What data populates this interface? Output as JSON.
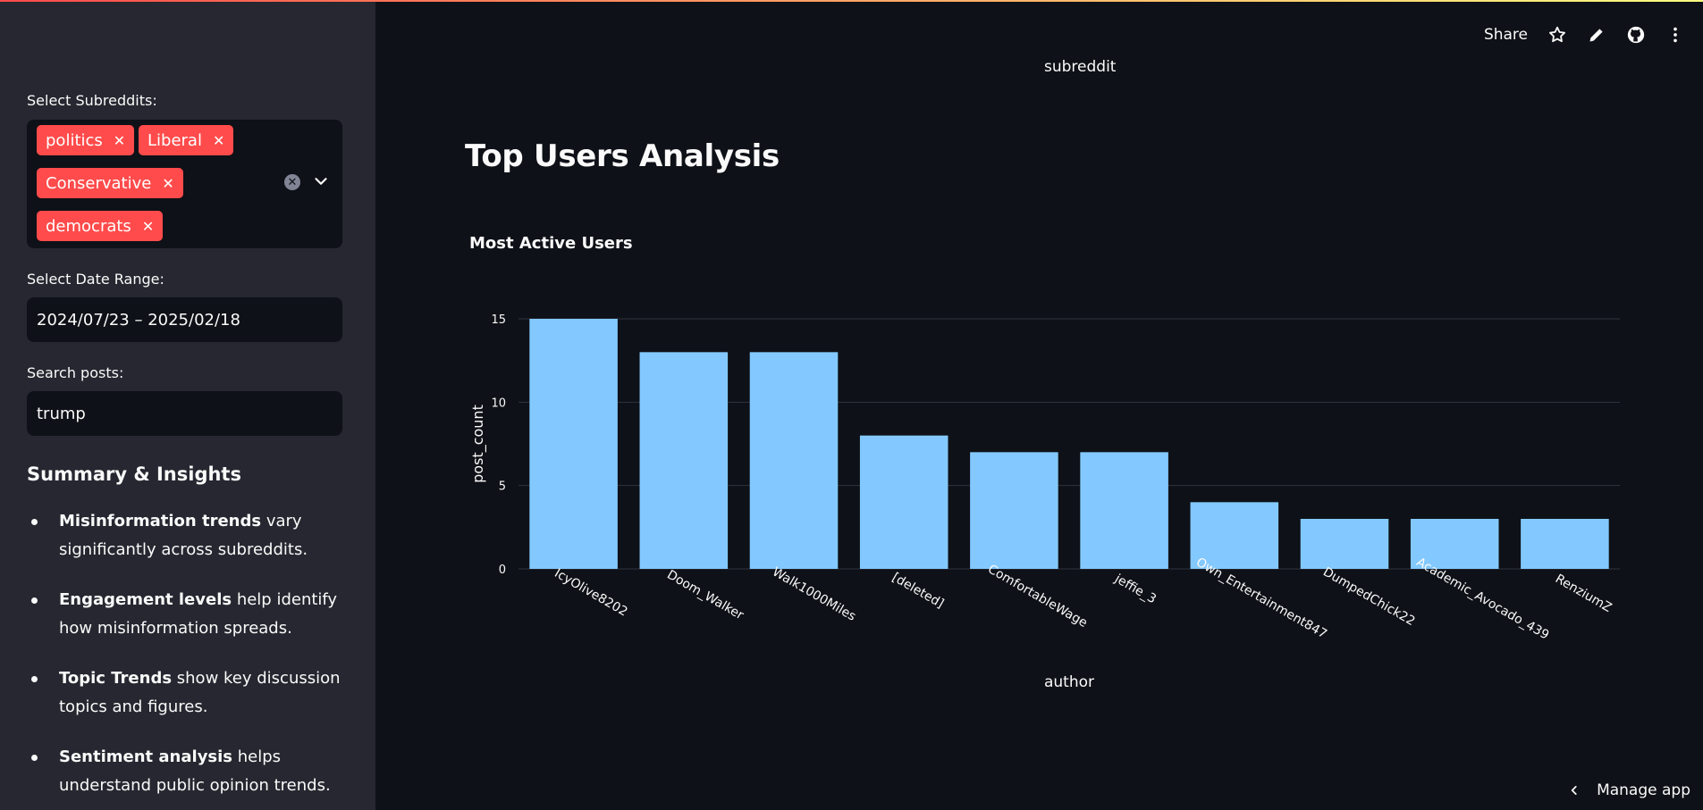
{
  "sidebar": {
    "subreddits_label": "Select Subreddits:",
    "subreddits": [
      {
        "label": "politics"
      },
      {
        "label": "Liberal"
      },
      {
        "label": "Conservative"
      },
      {
        "label": "democrats"
      }
    ],
    "date_label": "Select Date Range:",
    "date_value": "2024/07/23 – 2025/02/18",
    "search_label": "Search posts:",
    "search_value": "trump",
    "summary_heading": "Summary & Insights",
    "insights": [
      {
        "bold": "Misinformation trends",
        "rest": " vary significantly across subreddits."
      },
      {
        "bold": "Engagement levels",
        "rest": " help identify how misinformation spreads."
      },
      {
        "bold": "Topic Trends",
        "rest": " show key discussion topics and figures."
      },
      {
        "bold": "Sentiment analysis",
        "rest": " helps understand public opinion trends."
      }
    ]
  },
  "toolbar": {
    "share_label": "Share",
    "icons": [
      "star-icon",
      "pencil-icon",
      "github-icon",
      "more-icon"
    ]
  },
  "main": {
    "prev_chart_axis_label": "subreddit",
    "page_title": "Top Users Analysis",
    "chart_title": "Most Active Users",
    "manage_label": "Manage app"
  },
  "chart_data": {
    "type": "bar",
    "title": "Most Active Users",
    "xlabel": "author",
    "ylabel": "post_count",
    "ylim": [
      0,
      15
    ],
    "yticks": [
      0,
      5,
      10,
      15
    ],
    "grid": true,
    "bar_color": "#83c9ff",
    "categories": [
      "IcyOlive8202",
      "Doom_Walker",
      "Walk1000Miles",
      "[deleted]",
      "ComfortableWage",
      "jeffie_3",
      "Own_Entertainment847",
      "DumpedChick22",
      "Academic_Avocado_439",
      "RenziumZ"
    ],
    "values": [
      15,
      13,
      13,
      8,
      7,
      7,
      4,
      3,
      3,
      3
    ]
  },
  "colors": {
    "accent": "#ff4b4b",
    "background": "#0e1117",
    "sidebar": "#262730"
  }
}
